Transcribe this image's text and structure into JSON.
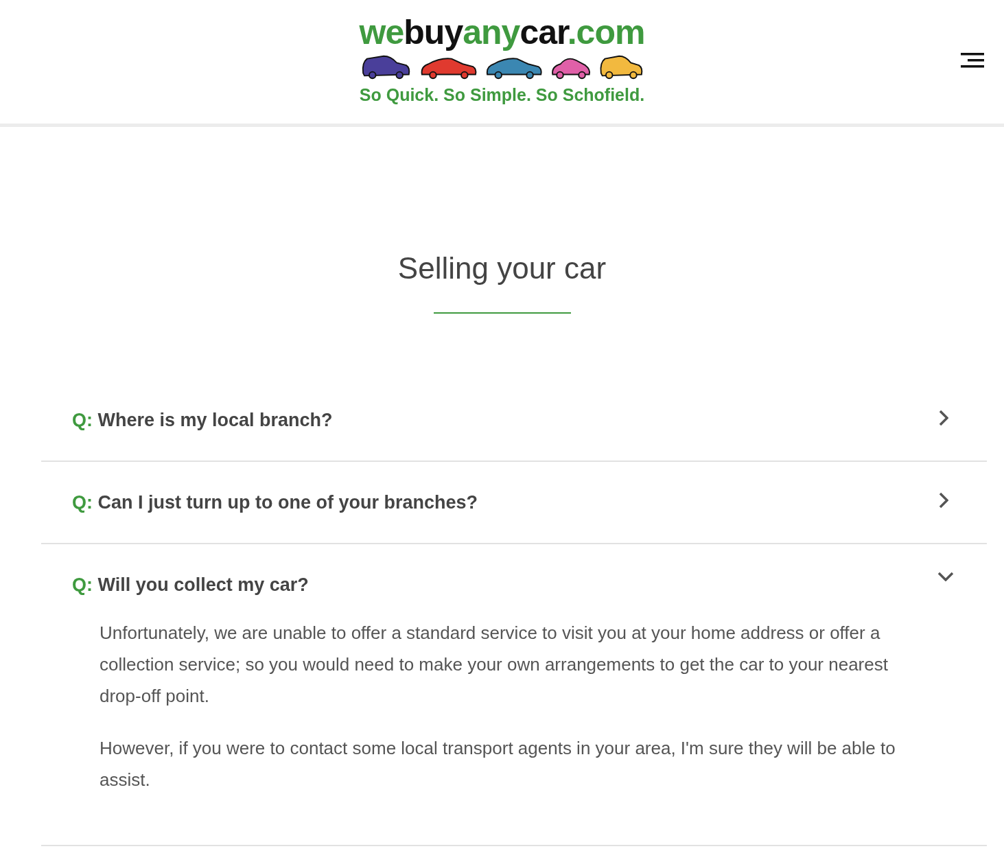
{
  "header": {
    "logo_parts": [
      {
        "text": "we",
        "color": "#3f9a3f"
      },
      {
        "text": "buy",
        "color": "#111111"
      },
      {
        "text": "any",
        "color": "#3f9a3f"
      },
      {
        "text": "car",
        "color": "#111111"
      },
      {
        "text": ".com",
        "color": "#3f9a3f"
      }
    ],
    "tagline": "So Quick. So Simple. So Schofield."
  },
  "heading": "Selling your car",
  "faq": [
    {
      "prefix": "Q:",
      "question": "Where is my local branch?",
      "expanded": false
    },
    {
      "prefix": "Q:",
      "question": "Can I just turn up to one of your branches?",
      "expanded": false
    },
    {
      "prefix": "Q:",
      "question": "Will you collect my car?",
      "expanded": true,
      "answer": [
        "Unfortunately, we are unable to offer a standard service to visit you at your home address or offer a collection service; so you would need to make your own arrangements to get the car to your nearest drop-off point.",
        "However, if you were to contact some local transport agents in your area, I'm sure they will be able to assist."
      ]
    }
  ]
}
